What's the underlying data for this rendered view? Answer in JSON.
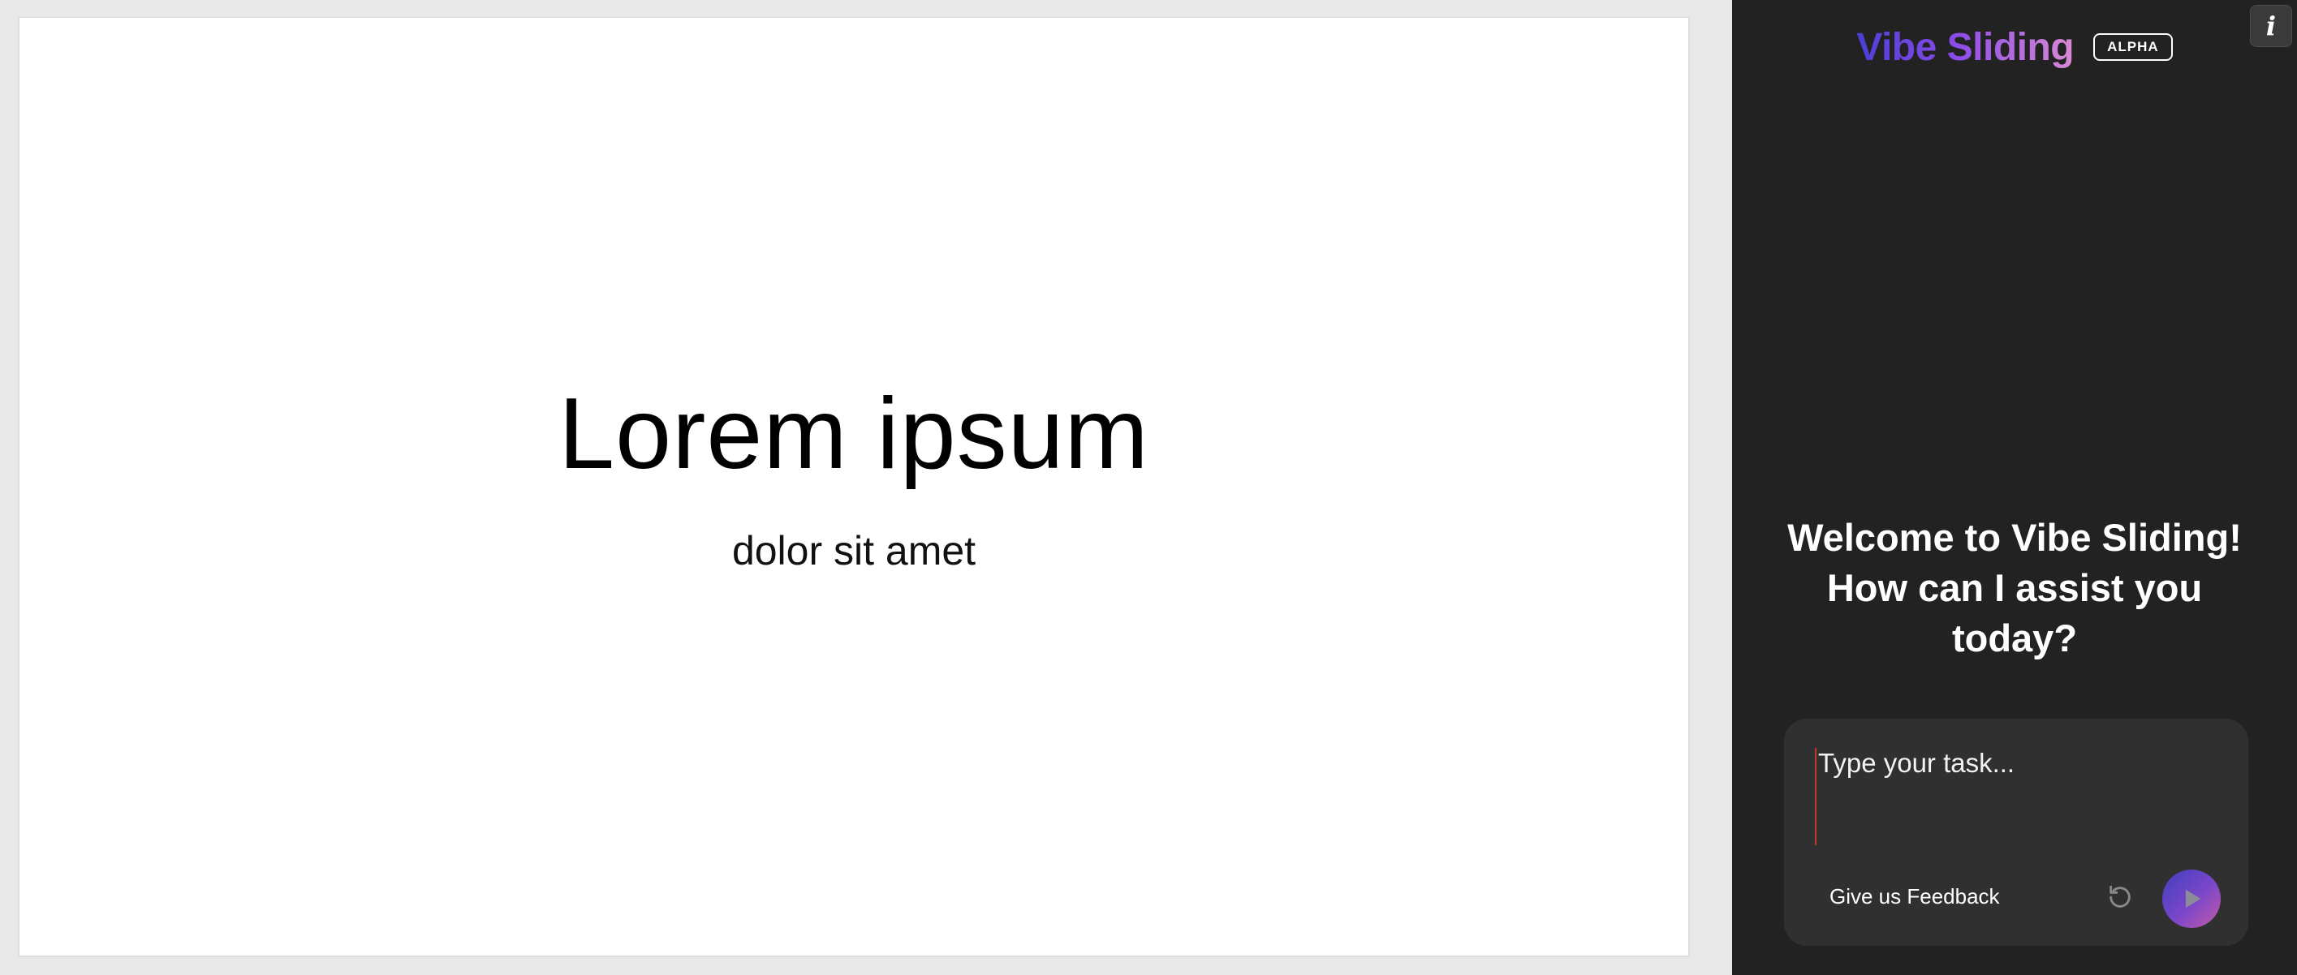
{
  "slide": {
    "title": "Lorem ipsum",
    "subtitle": "dolor sit amet"
  },
  "panel": {
    "brand_name": "Vibe Sliding",
    "badge": "ALPHA",
    "info_label": "i",
    "welcome_lines": [
      "Welcome to Vibe Sliding!",
      "How can I assist you",
      "today?"
    ],
    "input_placeholder": "Type your task...",
    "input_value": "",
    "feedback_label": "Give us Feedback",
    "icons": {
      "info": "info-icon",
      "reset": "refresh-icon",
      "send": "play-icon"
    },
    "colors": {
      "panel_bg": "#222222",
      "composer_bg": "#303030",
      "brand_gradient_start": "#4a3fd6",
      "brand_gradient_end": "#d98ad4"
    }
  }
}
